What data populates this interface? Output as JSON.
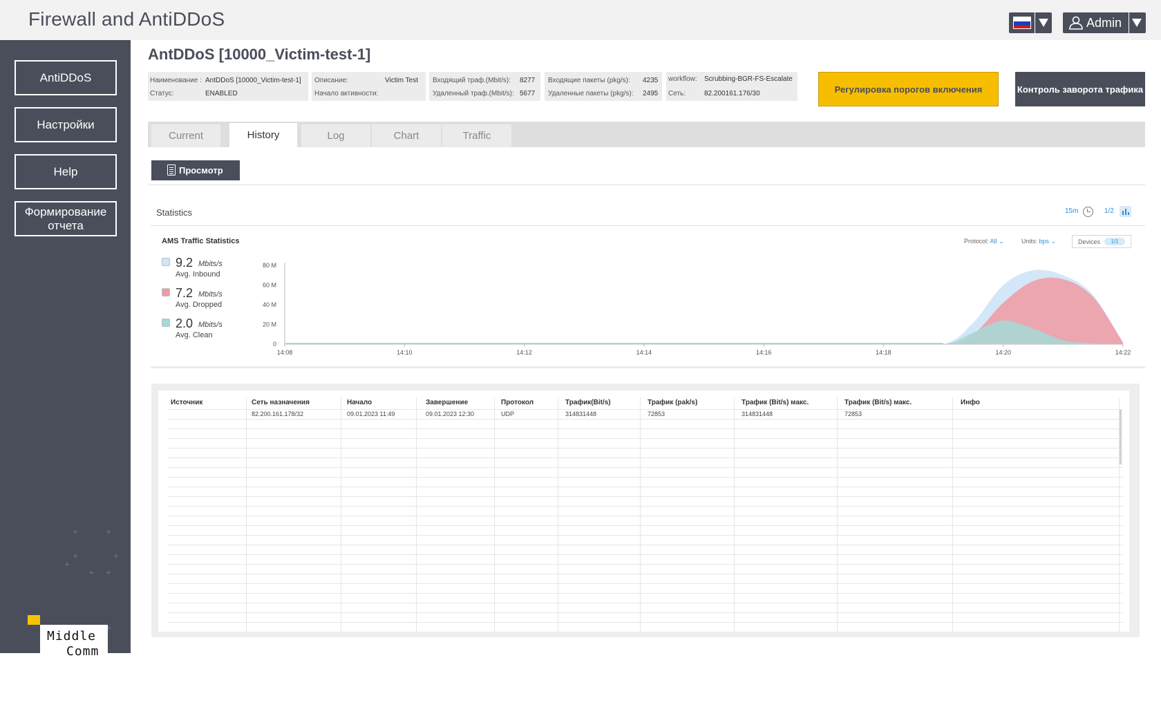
{
  "app": {
    "title": "Firewall and AntiDDoS"
  },
  "header": {
    "user_name": "Admin",
    "language_flag": "russia-flag"
  },
  "sidebar": {
    "items": [
      {
        "label": "AntiDDoS"
      },
      {
        "label": "Настройки"
      },
      {
        "label": "Help"
      },
      {
        "label": "Формирование отчета"
      }
    ],
    "logo": {
      "line1": "Middle",
      "line2": "Comm"
    }
  },
  "page": {
    "title": "AntDDoS [10000_Victim-test-1]",
    "info": {
      "name_label": "Наименование :",
      "name_value": "AntDDoS [10000_Victim-test-1]",
      "status_label": "Статус:",
      "status_value": "ENABLED",
      "description_label": "Описание:",
      "description_value": "Victim Test",
      "activity_start_label": "Начало активности:",
      "activity_start_value": "",
      "incoming_traffic_label": "Входящий траф.(Mbit/s):",
      "incoming_traffic_value": "8277",
      "removed_traffic_label": "Удаленный траф.(Mbit/s):",
      "removed_traffic_value": "5677",
      "incoming_packets_label": "Входящие пакеты (pkg/s):",
      "incoming_packets_value": "4235",
      "removed_packets_label": "Удаленные пакеты  (pkg/s):",
      "removed_packets_value": "2495",
      "workflow_label": "workflow:",
      "workflow_value": "Scrubbing-BGR-FS-Escalate",
      "network_label": "Сеть:",
      "network_value": "82.200161.176/30"
    },
    "buttons": {
      "threshold_label": "Регулировка порогов включения",
      "reversal_label": "Контроль заворота трафика",
      "view_label": "Просмотр"
    },
    "tabs": [
      {
        "label": "Current"
      },
      {
        "label": "History"
      },
      {
        "label": "Log"
      },
      {
        "label": "Chart"
      },
      {
        "label": "Traffic"
      }
    ],
    "active_tab": "History"
  },
  "statistics": {
    "title": "Statistics",
    "time_range": "15m",
    "page": "1/2",
    "chart_title": "AMS Traffic Statistics",
    "protocol_label": "Protocol:",
    "protocol_value": "All",
    "units_label": "Units:",
    "units_value": "bps",
    "devices_label": "Devices",
    "devices_value": "1/1",
    "legend": [
      {
        "value": "9.2",
        "unit": "Mbits/s",
        "caption": "Avg. Inbound",
        "color": "#cfe4f7"
      },
      {
        "value": "7.2",
        "unit": "Mbits/s",
        "caption": "Avg. Dropped",
        "color": "#ef9aa3"
      },
      {
        "value": "2.0",
        "unit": "Mbits/s",
        "caption": "Avg. Clean",
        "color": "#a6d9d6"
      }
    ]
  },
  "chart_data": {
    "type": "area",
    "x": [
      "14:08",
      "14:09",
      "14:10",
      "14:11",
      "14:12",
      "14:13",
      "14:14",
      "14:15",
      "14:16",
      "14:17",
      "14:18",
      "14:19",
      "14:19:30",
      "14:20",
      "14:20:30",
      "14:21",
      "14:21:30",
      "14:22"
    ],
    "x_ticks": [
      "14:08",
      "14:10",
      "14:12",
      "14:14",
      "14:16",
      "14:18",
      "14:20",
      "14:22"
    ],
    "y_ticks": [
      "80 M",
      "60 M",
      "40 M",
      "20 M",
      "0"
    ],
    "ylim": [
      0,
      80
    ],
    "series": [
      {
        "name": "Avg. Inbound",
        "color": "#cfe4f7",
        "values": [
          0,
          0,
          0,
          0,
          0,
          0,
          0,
          0,
          0,
          0,
          0,
          0,
          22,
          60,
          75,
          70,
          50,
          0
        ]
      },
      {
        "name": "Avg. Dropped",
        "color": "#ef9aa3",
        "values": [
          0,
          0,
          0,
          0,
          0,
          0,
          0,
          0,
          0,
          0,
          0,
          0,
          10,
          42,
          64,
          66,
          48,
          2
        ]
      },
      {
        "name": "Avg. Clean",
        "color": "#a6d9d6",
        "values": [
          0,
          0,
          0,
          0,
          0,
          0,
          0,
          0,
          0,
          0,
          0,
          0,
          12,
          24,
          16,
          4,
          1,
          0
        ]
      }
    ]
  },
  "table": {
    "columns": [
      "Источник",
      "Сеть назначения",
      "Начало",
      "Завершение",
      "Протокол",
      "Трафик(Bit/s)",
      "Трафик (pak/s)",
      "Трафик (Bit/s) макс.",
      "Трафик (Bit/s) макс.",
      "Инфо"
    ],
    "rows": [
      [
        "",
        "82.200.161.178/32",
        "09.01.2023 11:49",
        "09.01.2023 12:30",
        "UDP",
        "314831448",
        "72853",
        "314831448",
        "72853",
        ""
      ]
    ]
  }
}
